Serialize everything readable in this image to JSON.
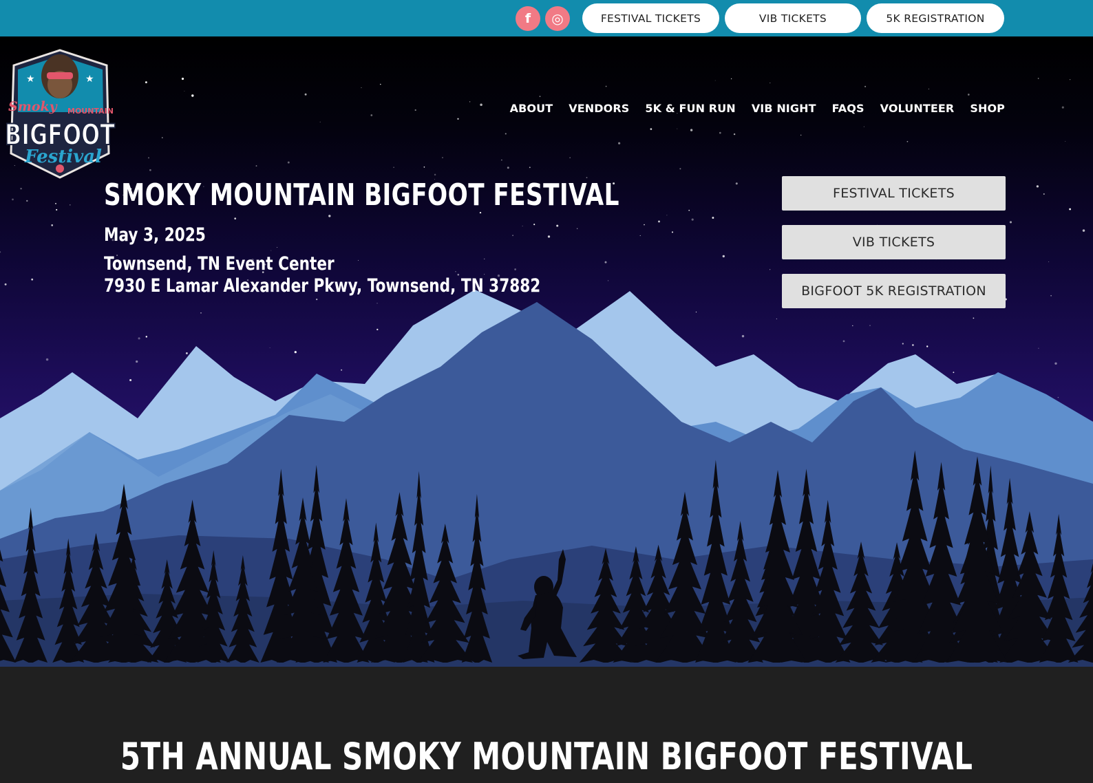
{
  "topbar": {
    "social": [
      {
        "name": "facebook",
        "glyph": "f"
      },
      {
        "name": "instagram",
        "glyph": "◎"
      }
    ],
    "buttons": [
      "FESTIVAL TICKETS",
      "VIB TICKETS",
      "5K REGISTRATION"
    ]
  },
  "logo": {
    "line1": "Smoky",
    "line2": "MOUNTAIN",
    "line3": "BIGFOOT",
    "line4": "Festival"
  },
  "nav": [
    "ABOUT",
    "VENDORS",
    "5K & FUN RUN",
    "VIB NIGHT",
    "FAQS",
    "VOLUNTEER",
    "SHOP"
  ],
  "hero": {
    "title": "SMOKY MOUNTAIN BIGFOOT FESTIVAL",
    "date": "May 3, 2025",
    "venue": "Townsend, TN Event Center",
    "address": "7930 E Lamar Alexander Pkwy, Townsend, TN 37882",
    "cta": [
      "FESTIVAL TICKETS",
      "VIB TICKETS",
      "BIGFOOT 5K REGISTRATION"
    ]
  },
  "section": {
    "title": "5TH ANNUAL SMOKY MOUNTAIN BIGFOOT FESTIVAL"
  },
  "colors": {
    "topbar": "#128cad",
    "social": "#f17a85",
    "dark": "#202020"
  }
}
